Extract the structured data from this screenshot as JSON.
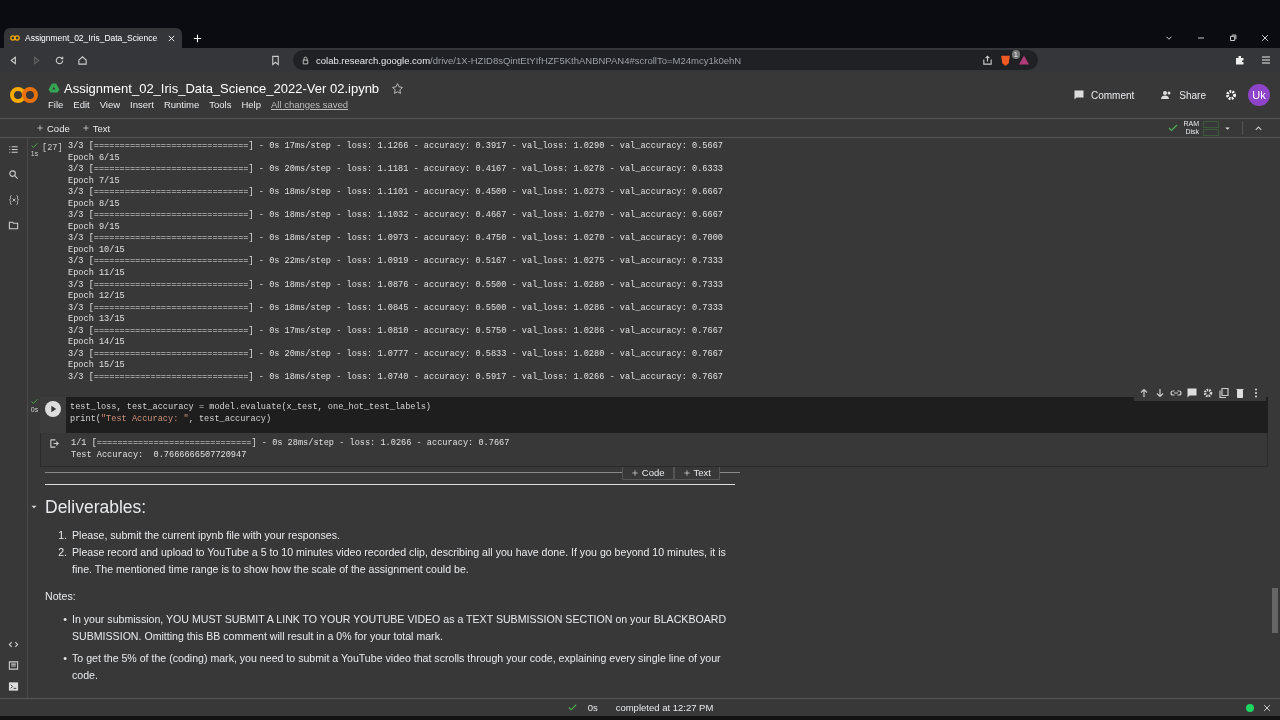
{
  "browser": {
    "tab_title": "Assignment_02_Iris_Data_Science",
    "url_host": "colab.research.google.com",
    "url_path": "/drive/1X-HZID8sQintEtYIfHZF5KthANBNPAN4#scrollTo=M24mcy1k0ehN",
    "extension_badge": "1"
  },
  "header": {
    "title": "Assignment_02_Iris_Data_Science_2022-Ver 02.ipynb",
    "menu": [
      "File",
      "Edit",
      "View",
      "Insert",
      "Runtime",
      "Tools",
      "Help"
    ],
    "save_status": "All changes saved",
    "actions": [
      "Comment",
      "Share"
    ],
    "avatar": "Uk"
  },
  "toolbar": {
    "add_buttons": [
      "Code",
      "Text"
    ],
    "resources": [
      "RAM",
      "Disk"
    ]
  },
  "cells": [
    {
      "kind": "output",
      "exec_count": "[27]",
      "time": "1s",
      "lines": [
        "3/3 [==============================] - 0s 17ms/step - loss: 1.1266 - accuracy: 0.3917 - val_loss: 1.0290 - val_accuracy: 0.5667",
        "Epoch 6/15",
        "3/3 [==============================] - 0s 20ms/step - loss: 1.1181 - accuracy: 0.4167 - val_loss: 1.0278 - val_accuracy: 0.6333",
        "Epoch 7/15",
        "3/3 [==============================] - 0s 18ms/step - loss: 1.1101 - accuracy: 0.4500 - val_loss: 1.0273 - val_accuracy: 0.6667",
        "Epoch 8/15",
        "3/3 [==============================] - 0s 18ms/step - loss: 1.1032 - accuracy: 0.4667 - val_loss: 1.0270 - val_accuracy: 0.6667",
        "Epoch 9/15",
        "3/3 [==============================] - 0s 18ms/step - loss: 1.0973 - accuracy: 0.4750 - val_loss: 1.0270 - val_accuracy: 0.7000",
        "Epoch 10/15",
        "3/3 [==============================] - 0s 22ms/step - loss: 1.0919 - accuracy: 0.5167 - val_loss: 1.0275 - val_accuracy: 0.7333",
        "Epoch 11/15",
        "3/3 [==============================] - 0s 18ms/step - loss: 1.0876 - accuracy: 0.5500 - val_loss: 1.0280 - val_accuracy: 0.7333",
        "Epoch 12/15",
        "3/3 [==============================] - 0s 18ms/step - loss: 1.0845 - accuracy: 0.5500 - val_loss: 1.0286 - val_accuracy: 0.7333",
        "Epoch 13/15",
        "3/3 [==============================] - 0s 17ms/step - loss: 1.0810 - accuracy: 0.5750 - val_loss: 1.0286 - val_accuracy: 0.7667",
        "Epoch 14/15",
        "3/3 [==============================] - 0s 20ms/step - loss: 1.0777 - accuracy: 0.5833 - val_loss: 1.0280 - val_accuracy: 0.7667",
        "Epoch 15/15",
        "3/3 [==============================] - 0s 18ms/step - loss: 1.0740 - accuracy: 0.5917 - val_loss: 1.0266 - val_accuracy: 0.7667"
      ]
    },
    {
      "kind": "code",
      "time": "0s",
      "code": [
        [
          {
            "kind": "plain",
            "text": "test_loss, test_accuracy = model.evaluate(x_test, one_hot_test_labels)"
          }
        ],
        [
          {
            "kind": "plain",
            "text": "print("
          },
          {
            "kind": "string",
            "text": "\"Test Accuracy: \""
          },
          {
            "kind": "plain",
            "text": ", test_accuracy)"
          }
        ]
      ],
      "output": [
        "1/1 [==============================] - 0s 28ms/step - loss: 1.0266 - accuracy: 0.7667",
        "Test Accuracy:  0.7666666507720947"
      ],
      "insert_buttons": [
        "Code",
        "Text"
      ]
    },
    {
      "kind": "markdown",
      "heading": "Deliverables:",
      "expanded": true,
      "ordered": [
        {
          "marker": "1.",
          "text": "Please, submit the current ipynb file with your responses."
        },
        {
          "marker": "2.",
          "text": "Please record and upload to YouTube a 5 to 10 minutes video recorded clip, describing all you have done. If you go beyond 10 minutes, it is fine. The mentioned time range is to show how the scale of the assignment could be."
        }
      ],
      "notes_label": "Notes:",
      "bullets": [
        {
          "marker": "•",
          "text": "In your submission, YOU MUST SUBMIT A LINK TO YOUR YOUTUBE VIDEO as a TEXT SUBMISSION SECTION on your BLACKBOARD SUBMISSION. Omitting this BB comment will result in a 0% for your total mark."
        },
        {
          "marker": "•",
          "text": "To get the 5% of the (coding) mark, you need to submit a YouTube video that scrolls through your code, explaining every single line of your code."
        }
      ]
    }
  ],
  "status_bar": {
    "time": "0s",
    "message": "completed at 12:27 PM"
  }
}
